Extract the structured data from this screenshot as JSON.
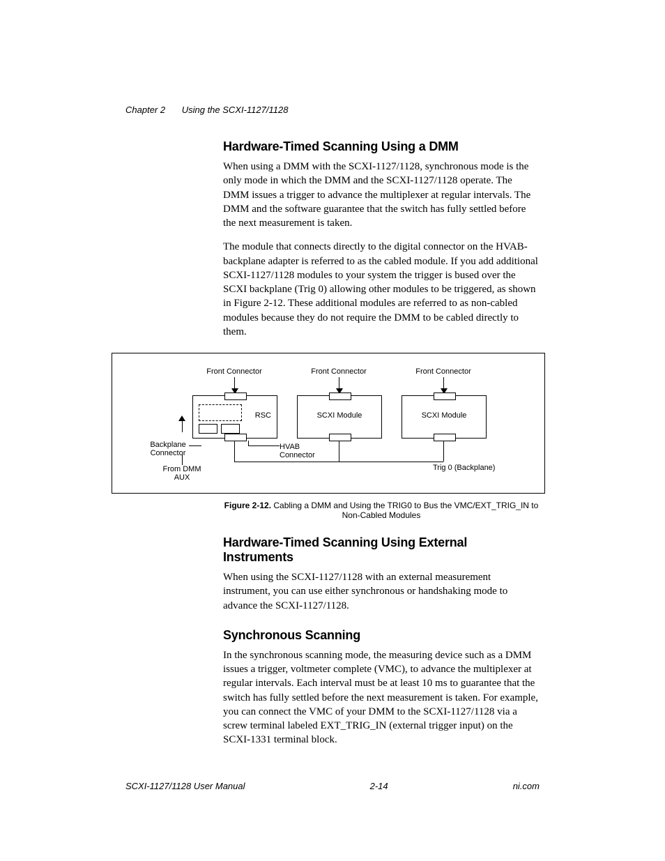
{
  "header": {
    "chapter": "Chapter 2",
    "title": "Using the SCXI-1127/1128"
  },
  "section1": {
    "heading": "Hardware-Timed Scanning Using a DMM",
    "p1": "When using a DMM with the SCXI-1127/1128, synchronous mode is the only mode in which the DMM and the SCXI-1127/1128 operate. The DMM issues a trigger to advance the multiplexer at regular intervals. The DMM and the software guarantee that the switch has fully settled before the next measurement is taken.",
    "p2": "The module that connects directly to the digital connector on the HVAB-backplane adapter is referred to as the cabled module. If you add additional SCXI-1127/1128 modules to your system the trigger is bused over the SCXI backplane (Trig 0) allowing other modules to be triggered, as shown in Figure 2-12. These additional modules are referred to as non-cabled modules because they do not require the DMM to be cabled directly to them."
  },
  "figure": {
    "labels": {
      "front_connector": "Front Connector",
      "rsc": "RSC",
      "scxi_module": "SCXI Module",
      "backplane_connector": "Backplane Connector",
      "hvab_connector": "HVAB Connector",
      "from_dmm_aux": "From DMM AUX",
      "trig0": "Trig 0 (Backplane)"
    },
    "caption_label": "Figure 2-12.",
    "caption_text": "Cabling a DMM and Using the TRIG0 to Bus the VMC/EXT_TRIG_IN to Non-Cabled Modules"
  },
  "section2": {
    "heading": "Hardware-Timed Scanning Using External Instruments",
    "p1": "When using the SCXI-1127/1128 with an external measurement instrument, you can use either synchronous or handshaking mode to advance the SCXI-1127/1128."
  },
  "section3": {
    "heading": "Synchronous Scanning",
    "p1": "In the synchronous scanning mode, the measuring device such as a DMM issues a trigger, voltmeter complete (VMC), to advance the multiplexer at regular intervals. Each interval must be at least 10 ms to guarantee that the switch has fully settled before the next measurement is taken. For example, you can connect the VMC of your DMM to the SCXI-1127/1128 via a screw terminal labeled EXT_TRIG_IN (external trigger input) on the SCXI-1331 terminal block."
  },
  "footer": {
    "left": "SCXI-1127/1128 User Manual",
    "center": "2-14",
    "right": "ni.com"
  }
}
